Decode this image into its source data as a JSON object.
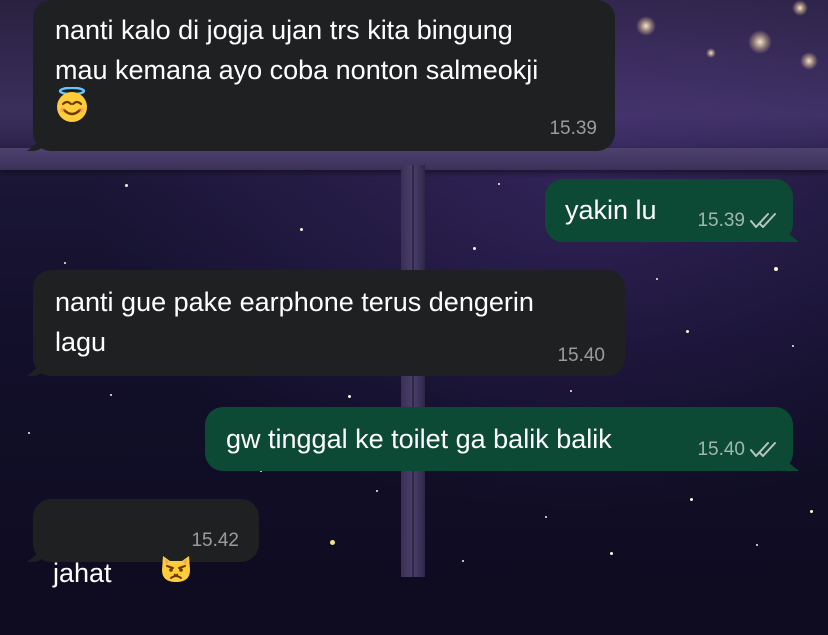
{
  "chat": {
    "messages": [
      {
        "direction": "incoming",
        "text_line1": "nanti kalo di jogja ujan trs kita bingung",
        "text_line2": "mau kemana ayo coba nonton salmeokji",
        "emoji": "smiling-face-with-halo",
        "time": "15.39"
      },
      {
        "direction": "outgoing",
        "text": "yakin lu",
        "time": "15.39",
        "status": "read"
      },
      {
        "direction": "incoming",
        "text_line1": "nanti gue pake earphone terus dengerin",
        "text_line2": "lagu",
        "time": "15.40"
      },
      {
        "direction": "outgoing",
        "text": "gw tinggal ke toilet ga balik balik",
        "time": "15.40",
        "status": "read"
      },
      {
        "direction": "incoming",
        "text": "jahat",
        "emoji": "pouting-cat-face",
        "time": "15.42"
      }
    ]
  },
  "colors": {
    "incoming_bubble": "#1f2022",
    "outgoing_bubble": "#0d4a36",
    "read_ticks": "#b8c4c0"
  }
}
